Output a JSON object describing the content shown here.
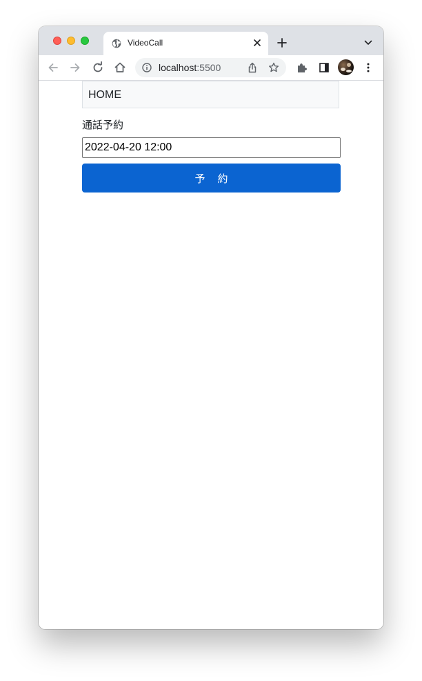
{
  "browser": {
    "tab": {
      "title": "VideoCall"
    },
    "omnibox": {
      "host": "localhost",
      "port": ":5500"
    }
  },
  "page": {
    "navbar": {
      "brand": "HOME"
    },
    "form": {
      "label": "通話予約",
      "datetime_value": "2022-04-20 12:00",
      "submit_label": "予約"
    }
  },
  "colors": {
    "accent": "#0b64d1",
    "navbar_bg": "#f8f9fa"
  }
}
